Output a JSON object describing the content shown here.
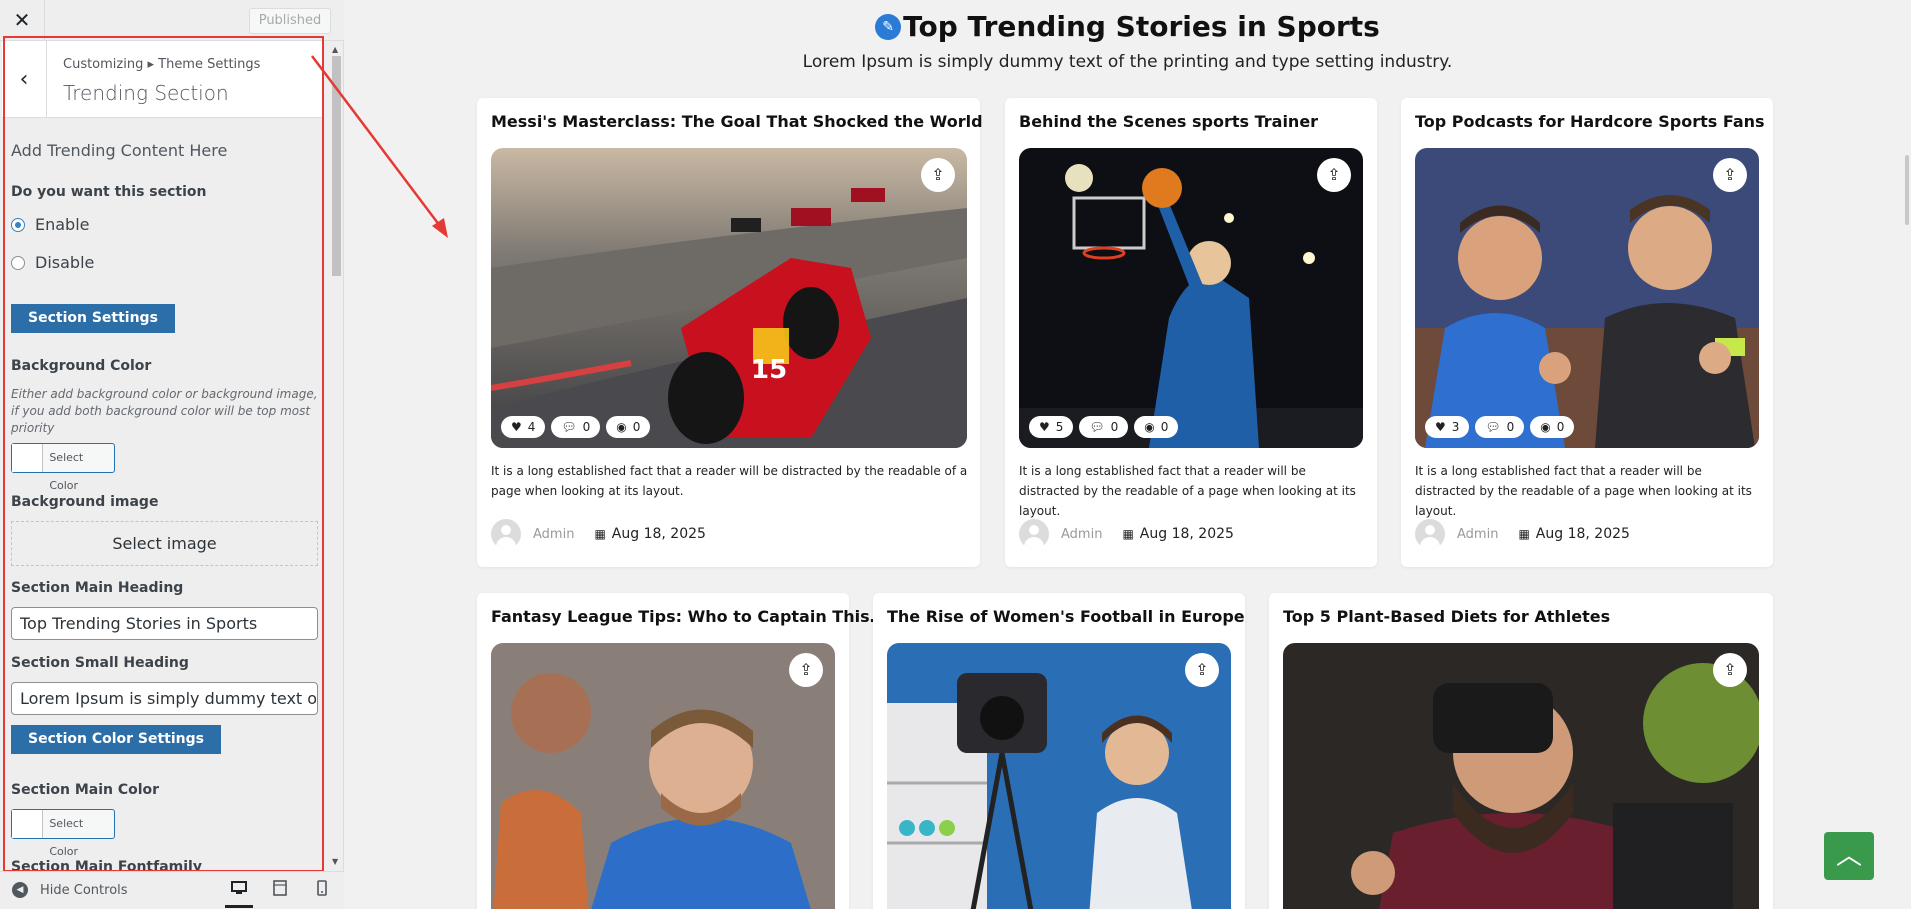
{
  "topbar": {
    "close_glyph": "✕",
    "publish_label": "Published"
  },
  "panel": {
    "back_glyph": "‹",
    "breadcrumb": "Customizing ▸ Theme Settings",
    "title": "Trending Section",
    "description": "Add Trending Content Here",
    "enable_question": "Do you want this section",
    "radio_enable": "Enable",
    "radio_disable": "Disable",
    "selected_option": "Enable",
    "section_settings_btn": "Section Settings",
    "bg_color_label": "Background Color",
    "bg_color_note": "Either add background color or background image, if you add both background color will be top most priority",
    "select_color_label": "Select Color",
    "bg_image_label": "Background image",
    "select_image_btn": "Select image",
    "main_heading_label": "Section Main Heading",
    "main_heading_value": "Top Trending Stories in Sports",
    "small_heading_label": "Section Small Heading",
    "small_heading_value": "Lorem Ipsum is simply dummy text of the printing and type setting industry.",
    "color_settings_btn": "Section Color Settings",
    "main_color_label": "Section Main Color",
    "main_color_select": "Select Color",
    "fontfamily_label": "Section Main Fontfamily"
  },
  "footer": {
    "hide_controls": "Hide Controls"
  },
  "preview": {
    "heading": "Top Trending Stories in Sports",
    "subheading": "Lorem Ipsum is simply dummy text of the printing and type setting industry.",
    "accent_green": "#3a9a4c",
    "cards": [
      {
        "title": "Messi's Masterclass: The Goal That Shocked the World",
        "likes": "4",
        "comments": "0",
        "views": "0",
        "excerpt": "It is a long established fact that a reader will be distracted by the readable of a page when looking at its layout.",
        "author": "Admin",
        "date": "Aug 18, 2025"
      },
      {
        "title": "Behind the Scenes sports Trainer",
        "likes": "5",
        "comments": "0",
        "views": "0",
        "excerpt": "It is a long established fact that a reader will be distracted by the readable of a page when looking at its layout.",
        "author": "Admin",
        "date": "Aug 18, 2025"
      },
      {
        "title": "Top Podcasts for Hardcore Sports Fans",
        "likes": "3",
        "comments": "0",
        "views": "0",
        "excerpt": "It is a long established fact that a reader will be distracted by the readable of a page when looking at its layout.",
        "author": "Admin",
        "date": "Aug 18, 2025"
      },
      {
        "title": "Fantasy League Tips: Who to Captain This…"
      },
      {
        "title": "The Rise of Women's Football in Europe"
      },
      {
        "title": "Top 5 Plant-Based Diets for Athletes"
      }
    ]
  }
}
